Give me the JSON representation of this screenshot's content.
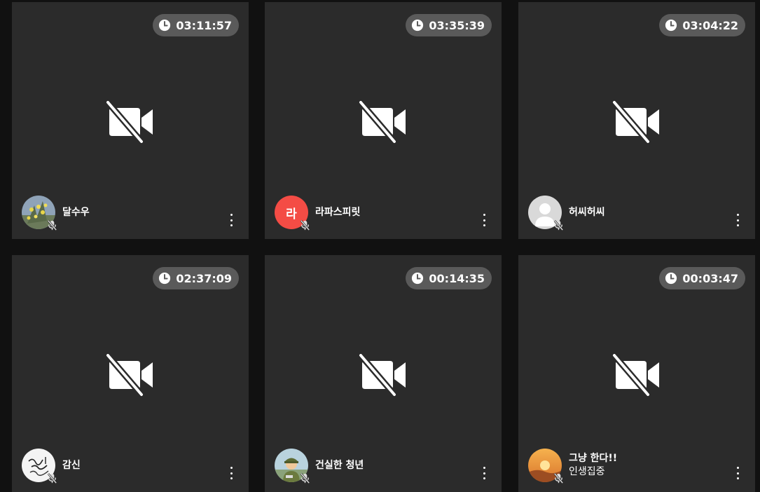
{
  "tiles": [
    {
      "timer": "03:11:57",
      "name": "달수우",
      "subname": "",
      "avatar": "photo-flowers-icon",
      "avatar_letter": ""
    },
    {
      "timer": "03:35:39",
      "name": "라파스피릿",
      "subname": "",
      "avatar": "letter",
      "avatar_letter": "라"
    },
    {
      "timer": "03:04:22",
      "name": "허씨허씨",
      "subname": "",
      "avatar": "default-user-icon",
      "avatar_letter": ""
    },
    {
      "timer": "02:37:09",
      "name": "감신",
      "subname": "",
      "avatar": "calligraphy-icon",
      "avatar_letter": ""
    },
    {
      "timer": "00:14:35",
      "name": "건실한 청년",
      "subname": "",
      "avatar": "soldier-illustration-icon",
      "avatar_letter": ""
    },
    {
      "timer": "00:03:47",
      "name": "그냥 한다!!",
      "subname": "인생집중",
      "avatar": "sunset-icon",
      "avatar_letter": ""
    }
  ],
  "colors": {
    "background": "#111111",
    "tile": "#2b2b2b",
    "timer_pill": "#5a5a5a",
    "letter_avatar": "#f44c45"
  },
  "icons": {
    "timer": "clock-icon",
    "video": "video-off-icon",
    "mic": "mic-off-icon",
    "menu": "more-vertical-icon"
  }
}
